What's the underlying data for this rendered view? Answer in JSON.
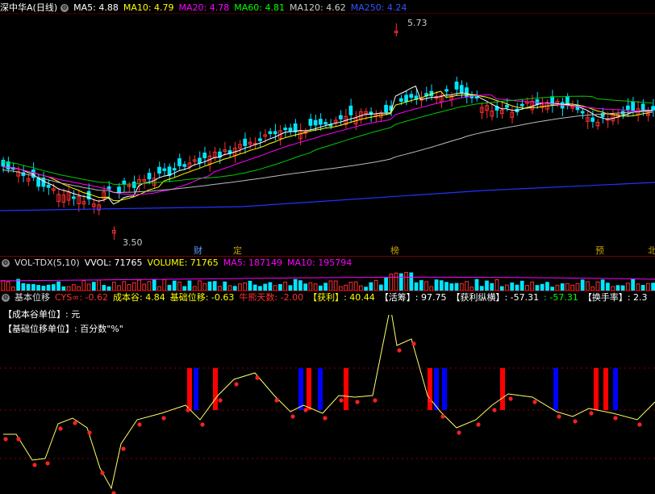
{
  "main_panel": {
    "symbol": "深中华A(日线)",
    "ma": [
      {
        "label": "MA5:",
        "value": "4.88",
        "color": "#ffffff"
      },
      {
        "label": "MA10:",
        "value": "4.79",
        "color": "#ffff00"
      },
      {
        "label": "MA20:",
        "value": "4.78",
        "color": "#ff00ff"
      },
      {
        "label": "MA60:",
        "value": "4.81",
        "color": "#00ff00"
      },
      {
        "label": "MA120:",
        "value": "4.62",
        "color": "#cccccc"
      },
      {
        "label": "MA250:",
        "value": "4.24",
        "color": "#3355ff"
      }
    ],
    "high_label": "5.73",
    "low_label": "3.50",
    "events": [
      "财",
      "定",
      "榜",
      "预",
      "北"
    ]
  },
  "volume_panel": {
    "title": "VOL-TDX(5,10)",
    "items": [
      {
        "label": "VVOL:",
        "value": "71765",
        "color": "#ffffff"
      },
      {
        "label": "VOLUME:",
        "value": "71765",
        "color": "#ffff00"
      },
      {
        "label": "MA5:",
        "value": "187149",
        "color": "#ff00ff"
      },
      {
        "label": "MA10:",
        "value": "195794",
        "color": "#ff00ff"
      }
    ]
  },
  "indicator_panel": {
    "title": "基本位移",
    "items": [
      {
        "label": "CYS∞:",
        "value": "-0.62",
        "color": "#ff3030"
      },
      {
        "label": "成本谷:",
        "value": "4.84",
        "color": "#ffff00"
      },
      {
        "label": "基础位移:",
        "value": "-0.63",
        "color": "#ffff00"
      },
      {
        "label": "牛熊天数:",
        "value": "-2.00",
        "color": "#ff3030"
      },
      {
        "label": "【获利】:",
        "value": "40.44",
        "color": "#ffff00"
      },
      {
        "label": "【活筹】:",
        "value": "97.75",
        "color": "#ffffff"
      },
      {
        "label": "【获利纵横】:",
        "value": "-57.31",
        "color": "#ffffff"
      },
      {
        "label": ":",
        "value": "-57.31",
        "color": "#00ff00"
      },
      {
        "label": "【换手率】:",
        "value": "2.3",
        "color": "#ffffff"
      }
    ],
    "line1": "【成本谷单位】: 元",
    "line2": "【基础位移单位】: 百分数\"%\""
  },
  "colors": {
    "up": "#ff3030",
    "down": "#00e5ff",
    "grid": "#7a0000",
    "bar_red": "#ff0000",
    "bar_blue": "#0000ff",
    "dot": "#ff2020",
    "line": "#ffff66"
  }
}
